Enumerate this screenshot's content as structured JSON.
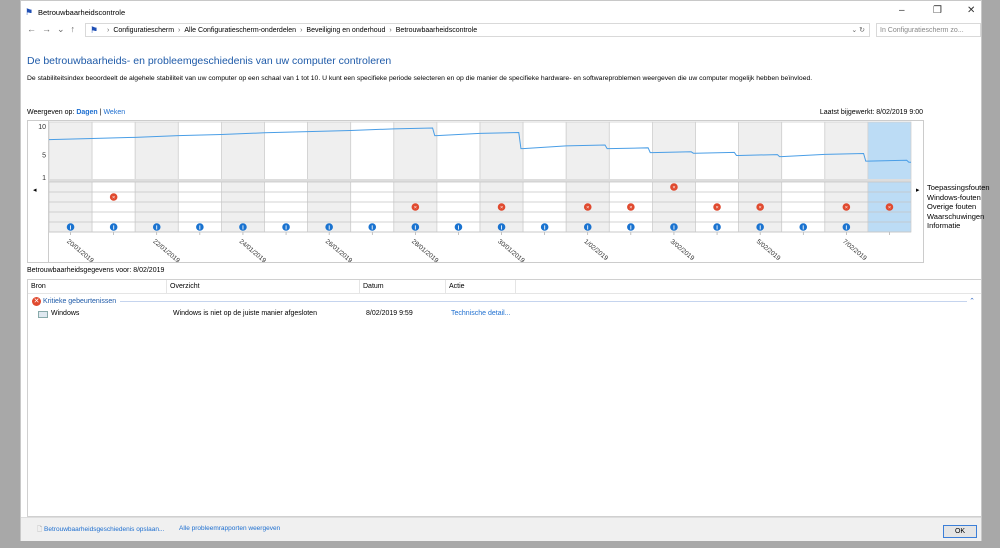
{
  "window": {
    "title": "Betrouwbaarheidscontrole",
    "minimize": "–",
    "maximize": "❐",
    "close": "✕"
  },
  "address": {
    "crumbs": [
      "Configuratiescherm",
      "Alle Configuratiescherm-onderdelen",
      "Beveiliging en onderhoud",
      "Betrouwbaarheidscontrole"
    ],
    "search_placeholder": "In Configuratiescherm zo..."
  },
  "main": {
    "heading": "De betrouwbaarheids- en probleemgeschiedenis van uw computer controleren",
    "description": "De stabiliteitsindex beoordeelt de algehele stabiliteit van uw computer op een schaal van 1 tot 10. U kunt een specifieke periode selecteren en op die manier de specifieke hardware- en softwareproblemen weergeven die uw computer mogelijk hebben beïnvloed.",
    "view_by_label": "Weergeven op:",
    "view_days": "Dagen",
    "view_sep": "|",
    "view_weeks": "Weken",
    "last_updated": "Laatst bijgewerkt: 8/02/2019 9:00"
  },
  "chart_data": {
    "type": "line",
    "y_ticks": [
      "10",
      "5",
      "1"
    ],
    "ylim": [
      1,
      10
    ],
    "dates": [
      "20/01/2019",
      "21/01/2019",
      "22/01/2019",
      "23/01/2019",
      "24/01/2019",
      "25/01/2019",
      "26/01/2019",
      "27/01/2019",
      "28/01/2019",
      "29/01/2019",
      "30/01/2019",
      "31/01/2019",
      "1/02/2019",
      "2/02/2019",
      "3/02/2019",
      "4/02/2019",
      "5/02/2019",
      "6/02/2019",
      "7/02/2019",
      "8/02/2019"
    ],
    "date_labels": [
      "20/01/2019",
      "22/01/2019",
      "24/01/2019",
      "26/01/2019",
      "28/01/2019",
      "30/01/2019",
      "1/02/2019",
      "3/02/2019",
      "5/02/2019",
      "7/02/2019"
    ],
    "stability_start": 7.6,
    "stability_index": [
      7.8,
      8.0,
      8.3,
      8.5,
      8.8,
      9.0,
      9.2,
      9.5,
      8.3,
      8.7,
      6.0,
      6.5,
      6.0,
      5.3,
      5.2,
      4.8,
      4.6,
      5.0,
      3.8,
      3.6
    ],
    "selected_date": "8/02/2019",
    "event_rows": [
      "Toepassingsfouten",
      "Windows-fouten",
      "Overige fouten",
      "Waarschuwingen",
      "Informatie"
    ],
    "events": {
      "Toepassingsfouten": [
        15
      ],
      "Windows-fouten": [
        2
      ],
      "Overige fouten": [
        9,
        11,
        13,
        14,
        16,
        17,
        19,
        20
      ],
      "Waarschuwingen": [],
      "Informatie": [
        1,
        2,
        3,
        4,
        5,
        6,
        7,
        8,
        9,
        10,
        11,
        12,
        13,
        14,
        15,
        16,
        17,
        18,
        19
      ]
    },
    "colors": {
      "line": "#4a9ee6",
      "error": "#e04a2f",
      "info": "#1a73d0",
      "selected": "#bcdcf5",
      "shade": "#efefef"
    }
  },
  "details": {
    "label": "Betrouwbaarheidsgegevens voor: 8/02/2019",
    "columns": [
      "Bron",
      "Overzicht",
      "Datum",
      "Actie"
    ],
    "group": "Kritieke gebeurtenissen",
    "rows": [
      {
        "source": "Windows",
        "summary": "Windows is niet op de juiste manier afgesloten",
        "date": "8/02/2019 9:59",
        "action": "Technische detail..."
      }
    ]
  },
  "footer": {
    "save": "Betrouwbaarheidsgeschiedenis opslaan...",
    "all_reports": "Alle probleemrapporten weergeven",
    "ok": "OK"
  }
}
